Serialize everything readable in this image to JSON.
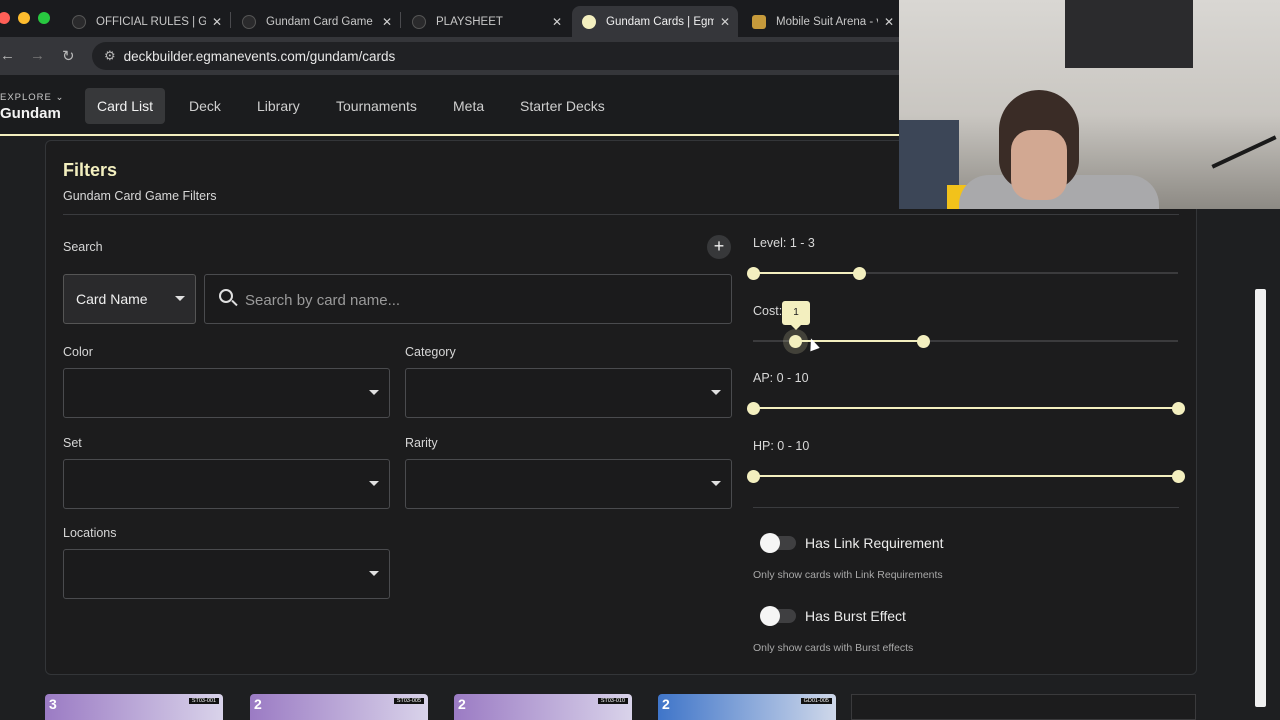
{
  "browser": {
    "tabs": [
      {
        "title": "OFFICIAL RULES | GU",
        "active": false
      },
      {
        "title": "Gundam Card Game (",
        "active": false
      },
      {
        "title": "PLAYSHEET",
        "active": false
      },
      {
        "title": "Gundam Cards | Egm",
        "active": true
      },
      {
        "title": "Mobile Suit Arena - v",
        "active": false
      }
    ],
    "url": "deckbuilder.egmanevents.com/gundam/cards"
  },
  "app": {
    "explore_label": "EXPLORE",
    "explore_chevron": "⌄",
    "brand": "Gundam",
    "nav": [
      "Card List",
      "Deck",
      "Library",
      "Tournaments",
      "Meta",
      "Starter Decks"
    ],
    "active_nav": "Card List"
  },
  "filters": {
    "title": "Filters",
    "subtitle": "Gundam Card Game Filters",
    "search_label": "Search",
    "add_icon": "+",
    "search_type": "Card Name",
    "search_placeholder": "Search by card name...",
    "color_label": "Color",
    "category_label": "Category",
    "set_label": "Set",
    "rarity_label": "Rarity",
    "locations_label": "Locations",
    "sliders": [
      {
        "label": "Level: 1 - 3",
        "min": 0,
        "max": 10,
        "low": 0,
        "high": 2.5
      },
      {
        "label": "Cost:",
        "min": 0,
        "max": 10,
        "low": 1,
        "high": 4
      },
      {
        "label": "AP: 0 - 10",
        "min": 0,
        "max": 10,
        "low": 0,
        "high": 10
      },
      {
        "label": "HP: 0 - 10",
        "min": 0,
        "max": 10,
        "low": 0,
        "high": 10
      }
    ],
    "tooltip_value": "1",
    "switches": [
      {
        "label": "Has Link Requirement",
        "help": "Only show cards with Link Requirements",
        "on": false
      },
      {
        "label": "Has Burst Effect",
        "help": "Only show cards with Burst effects",
        "on": false
      }
    ]
  },
  "cards": [
    {
      "level": "3",
      "code": "ST03-001"
    },
    {
      "level": "2",
      "code": "ST03-005"
    },
    {
      "level": "2",
      "code": "ST03-010"
    },
    {
      "level": "2",
      "code": "GD01-005"
    }
  ],
  "colors": {
    "accent": "#f3efbf",
    "background": "#1e1f21"
  }
}
